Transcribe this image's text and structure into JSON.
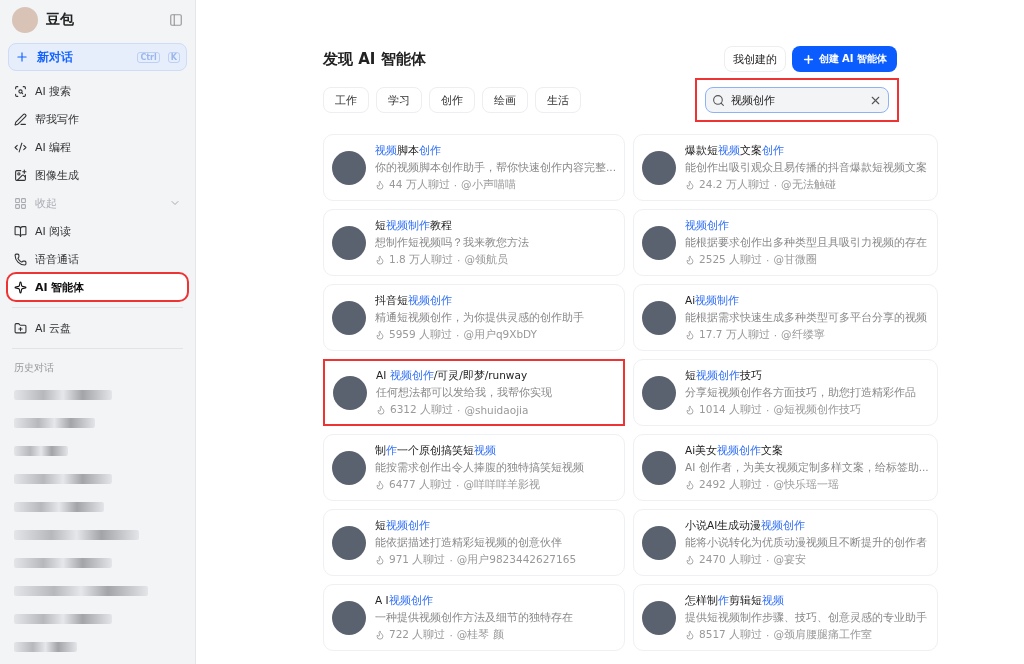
{
  "app": {
    "name": "豆包"
  },
  "new_chat": {
    "label": "新对话",
    "keys": [
      "Ctrl",
      "K"
    ]
  },
  "sidebar": {
    "items": [
      {
        "kind": "item",
        "label": "AI 搜索",
        "selected": false,
        "highlighted": false
      },
      {
        "kind": "item",
        "label": "帮我写作",
        "selected": false,
        "highlighted": false
      },
      {
        "kind": "item",
        "label": "AI 编程",
        "selected": false,
        "highlighted": false
      },
      {
        "kind": "item",
        "label": "图像生成",
        "selected": false,
        "highlighted": false
      },
      {
        "kind": "toggle",
        "label": "收起",
        "selected": false,
        "highlighted": false
      },
      {
        "kind": "item",
        "label": "AI 阅读",
        "selected": false,
        "highlighted": false
      },
      {
        "kind": "item",
        "label": "语音通话",
        "selected": false,
        "highlighted": false
      },
      {
        "kind": "item",
        "label": "AI 智能体",
        "selected": true,
        "highlighted": true
      },
      {
        "kind": "divider"
      },
      {
        "kind": "item",
        "label": "AI 云盘",
        "selected": false,
        "highlighted": false
      },
      {
        "kind": "divider"
      }
    ],
    "history_title": "历史对话",
    "history": [
      {
        "kind": "redacted"
      },
      {
        "kind": "redacted"
      },
      {
        "kind": "redacted"
      },
      {
        "kind": "redacted"
      },
      {
        "kind": "redacted"
      },
      {
        "kind": "redacted"
      },
      {
        "kind": "redacted"
      },
      {
        "kind": "redacted"
      },
      {
        "kind": "redacted"
      },
      {
        "kind": "redacted"
      }
    ]
  },
  "page": {
    "title": "发现 AI 智能体",
    "mine_button": "我创建的",
    "create_button": "创建 AI 智能体",
    "categories": [
      {
        "label": "工作",
        "selected": false
      },
      {
        "label": "学习",
        "selected": false
      },
      {
        "label": "创作",
        "selected": false
      },
      {
        "label": "绘画",
        "selected": false
      },
      {
        "label": "生活",
        "selected": false
      }
    ],
    "search": {
      "value": "视频创作",
      "highlighted": true
    }
  },
  "cards": [
    {
      "title": [
        {
          "text": "视频",
          "match": true
        },
        {
          "text": "脚本",
          "match": false
        },
        {
          "text": "创作",
          "match": true
        }
      ],
      "description": "你的视频脚本创作助手，帮你快速创作内容完整...",
      "chats": "44 万人聊过",
      "author": "@小声喵喵",
      "separator": "·",
      "highlighted": false
    },
    {
      "title": [
        {
          "text": "爆款短",
          "match": false
        },
        {
          "text": "视频",
          "match": true
        },
        {
          "text": "文案",
          "match": false
        },
        {
          "text": "创作",
          "match": true
        }
      ],
      "description": "能创作出吸引观众且易传播的抖音爆款短视频文案",
      "chats": "24.2 万人聊过",
      "author": "@无法触碰",
      "separator": "·",
      "highlighted": false
    },
    {
      "title": [
        {
          "text": "短",
          "match": false
        },
        {
          "text": "视频制作",
          "match": true
        },
        {
          "text": "教程",
          "match": false
        }
      ],
      "description": "想制作短视频吗？我来教您方法",
      "chats": "1.8 万人聊过",
      "author": "@领航员",
      "separator": "·",
      "highlighted": false
    },
    {
      "title": [
        {
          "text": "视频创作",
          "match": true
        }
      ],
      "description": "能根据要求创作出多种类型且具吸引力视频的存在",
      "chats": "2525 人聊过",
      "author": "@甘微圈",
      "separator": "·",
      "highlighted": false
    },
    {
      "title": [
        {
          "text": "抖音短",
          "match": false
        },
        {
          "text": "视频创作",
          "match": true
        }
      ],
      "description": "精通短视频创作，为你提供灵感的创作助手",
      "chats": "5959 人聊过",
      "author": "@用户q9XbDY",
      "separator": "·",
      "highlighted": false
    },
    {
      "title": [
        {
          "text": "Ai",
          "match": false
        },
        {
          "text": "视频制作",
          "match": true
        }
      ],
      "description": "能根据需求快速生成多种类型可多平台分享的视频",
      "chats": "17.7 万人聊过",
      "author": "@纤缕寧",
      "separator": "·",
      "highlighted": false
    },
    {
      "title": [
        {
          "text": "AI ",
          "match": false
        },
        {
          "text": "视频创作",
          "match": true
        },
        {
          "text": "/可灵/即梦/runway",
          "match": false
        }
      ],
      "description": "任何想法都可以发给我，我帮你实现",
      "chats": "6312 人聊过",
      "author": "@shuidaojia",
      "separator": "·",
      "highlighted": true
    },
    {
      "title": [
        {
          "text": "短",
          "match": false
        },
        {
          "text": "视频创作",
          "match": true
        },
        {
          "text": "技巧",
          "match": false
        }
      ],
      "description": "分享短视频创作各方面技巧，助您打造精彩作品",
      "chats": "1014 人聊过",
      "author": "@短视频创作技巧",
      "separator": "·",
      "highlighted": false
    },
    {
      "title": [
        {
          "text": "制",
          "match": false
        },
        {
          "text": "作",
          "match": true
        },
        {
          "text": "一个原创搞笑短",
          "match": false
        },
        {
          "text": "视频",
          "match": true
        }
      ],
      "description": "能按需求创作出令人捧腹的独特搞笑短视频",
      "chats": "6477 人聊过",
      "author": "@咩咩咩羊影视",
      "separator": "·",
      "highlighted": false
    },
    {
      "title": [
        {
          "text": "Ai美女",
          "match": false
        },
        {
          "text": "视频创作",
          "match": true
        },
        {
          "text": "文案",
          "match": false
        }
      ],
      "description": "AI 创作者，为美女视频定制多样文案，给标签助...",
      "chats": "2492 人聊过",
      "author": "@快乐瑶一瑶",
      "separator": "·",
      "highlighted": false
    },
    {
      "title": [
        {
          "text": "短",
          "match": false
        },
        {
          "text": "视频创作",
          "match": true
        }
      ],
      "description": "能依据描述打造精彩短视频的创意伙伴",
      "chats": "971 人聊过",
      "author": "@用户9823442627165",
      "separator": "·",
      "highlighted": false
    },
    {
      "title": [
        {
          "text": "小说AI生成动漫",
          "match": false
        },
        {
          "text": "视频创作",
          "match": true
        }
      ],
      "description": "能将小说转化为优质动漫视频且不断提升的创作者",
      "chats": "2470 人聊过",
      "author": "@宴安",
      "separator": "·",
      "highlighted": false
    },
    {
      "title": [
        {
          "text": "A I",
          "match": false
        },
        {
          "text": "视频创作",
          "match": true
        }
      ],
      "description": "一种提供视频创作方法及细节的独特存在",
      "chats": "722 人聊过",
      "author": "@桂琴 颜",
      "separator": "·",
      "highlighted": false
    },
    {
      "title": [
        {
          "text": "怎样制",
          "match": false
        },
        {
          "text": "作",
          "match": true
        },
        {
          "text": "剪辑短",
          "match": false
        },
        {
          "text": "视频",
          "match": true
        }
      ],
      "description": "提供短视频制作步骤、技巧、创意灵感的专业助手",
      "chats": "8517 人聊过",
      "author": "@颈肩腰腿痛工作室",
      "separator": "·",
      "highlighted": false
    }
  ]
}
